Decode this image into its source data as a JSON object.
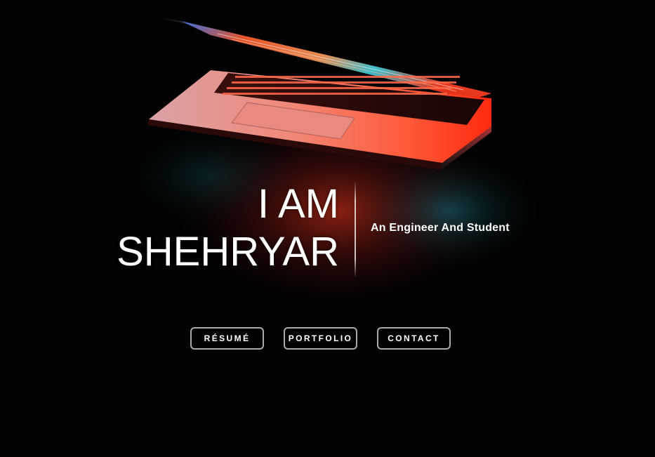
{
  "hero": {
    "image": "laptop-glow",
    "background_color": "#020202",
    "glow_colors": [
      "#ff3b1f",
      "#ff7a3d",
      "#18b0c8"
    ]
  },
  "intro": {
    "name_line1": "I AM",
    "name_line2": "SHEHRYAR",
    "tagline": "An Engineer And Student"
  },
  "nav": {
    "items": [
      {
        "label": "RÉSUMÉ"
      },
      {
        "label": "PORTFOLIO"
      },
      {
        "label": "CONTACT"
      }
    ],
    "border_color": "#a9a9a9"
  }
}
